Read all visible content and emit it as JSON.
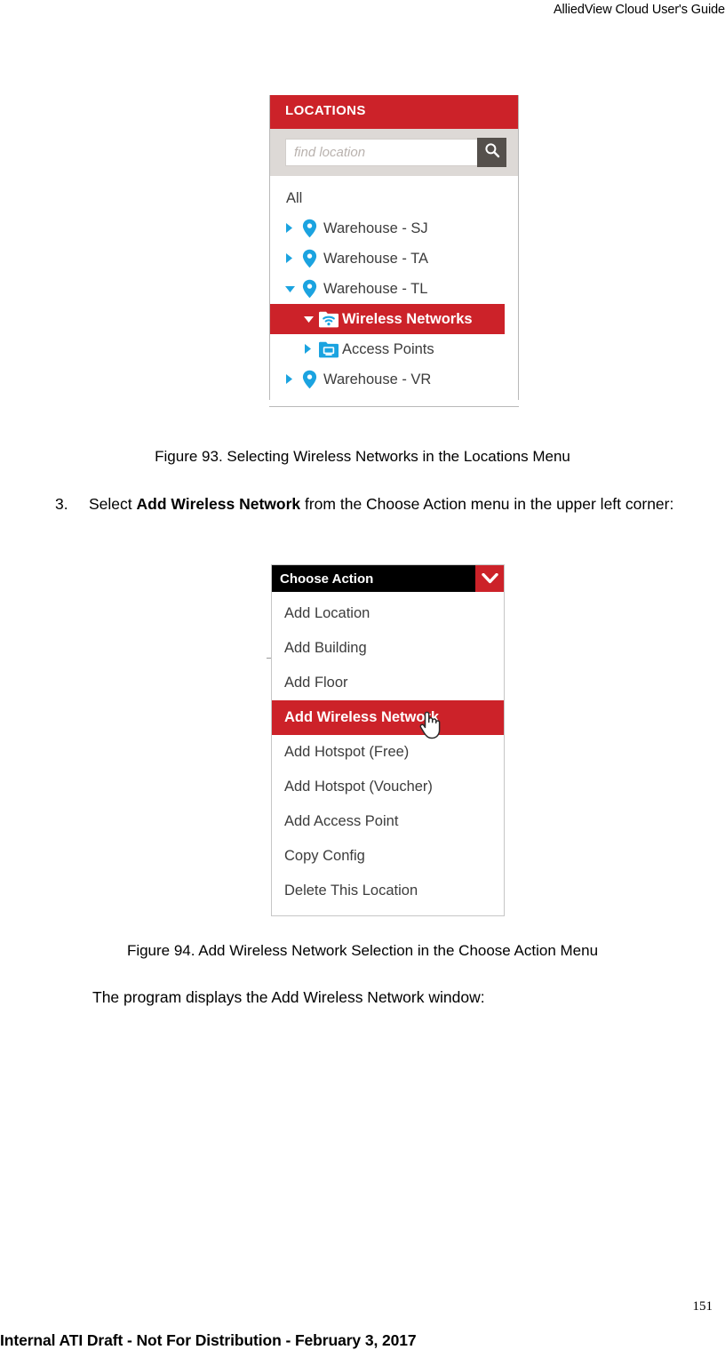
{
  "header": {
    "title": "AlliedView Cloud User's Guide"
  },
  "colors": {
    "accent_red": "#cc2229",
    "icon_blue": "#1ba3e0",
    "header_black": "#000000",
    "search_button_gray": "#55504c",
    "search_bar_bg": "#ddd9d6"
  },
  "figure93": {
    "panel_title": "LOCATIONS",
    "search": {
      "placeholder": "find location",
      "button_icon": "search-icon"
    },
    "tree": [
      {
        "label": "All",
        "arrow": "",
        "icon": "",
        "indent": 0,
        "selected": false
      },
      {
        "label": "Warehouse - SJ",
        "arrow": "▶",
        "icon": "map-pin-icon",
        "indent": 1,
        "selected": false
      },
      {
        "label": "Warehouse - TA",
        "arrow": "▶",
        "icon": "map-pin-icon",
        "indent": 1,
        "selected": false
      },
      {
        "label": "Warehouse - TL",
        "arrow": "▼",
        "icon": "map-pin-icon",
        "indent": 1,
        "selected": false
      },
      {
        "label": "Wireless Networks",
        "arrow": "▼",
        "icon": "wifi-folder-icon",
        "indent": 2,
        "selected": true
      },
      {
        "label": "Access Points",
        "arrow": "▶",
        "icon": "access-point-folder-icon",
        "indent": 2,
        "selected": false
      },
      {
        "label": "Warehouse - VR",
        "arrow": "▶",
        "icon": "map-pin-icon",
        "indent": 1,
        "selected": false
      }
    ],
    "caption": "Figure 93. Selecting Wireless Networks in the Locations Menu"
  },
  "step3": {
    "number": "3.",
    "text_before": "Select ",
    "bold": "Add Wireless Network",
    "text_after": " from the Choose Action menu in the upper left corner:"
  },
  "figure94": {
    "menu_header": "Choose Action",
    "chevron_icon": "chevron-down-icon",
    "items": [
      {
        "label": "Add Location",
        "selected": false
      },
      {
        "label": "Add Building",
        "selected": false
      },
      {
        "label": "Add Floor",
        "selected": false
      },
      {
        "label": "Add Wireless Network",
        "selected": true
      },
      {
        "label": "Add Hotspot (Free)",
        "selected": false
      },
      {
        "label": "Add Hotspot (Voucher)",
        "selected": false
      },
      {
        "label": "Add Access Point",
        "selected": false
      },
      {
        "label": "Copy Config",
        "selected": false
      },
      {
        "label": "Delete This Location",
        "selected": false
      }
    ],
    "cursor": "hand-cursor-icon",
    "caption": "Figure 94. Add Wireless Network Selection in the Choose Action Menu"
  },
  "body_paragraph": "The program displays the Add Wireless Network window:",
  "footer": {
    "page_number": "151",
    "note": "Internal ATI Draft - Not For Distribution - February 3, 2017"
  }
}
